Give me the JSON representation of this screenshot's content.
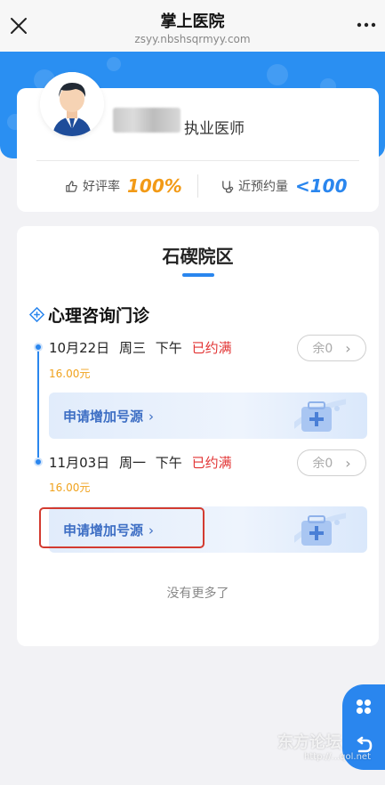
{
  "topbar": {
    "title": "掌上医院",
    "domain": "zsyy.nbshsqrmyy.com"
  },
  "doctor": {
    "title": "执业医师",
    "rating_label": "好评率",
    "rating_value": "100%",
    "booking_label": "近预约量",
    "booking_value": "<100"
  },
  "schedule": {
    "campus": "石碶院区",
    "department": "心理咨询门诊",
    "slots": [
      {
        "date": "10月22日",
        "weekday": "周三",
        "period": "下午",
        "status": "已约满",
        "price": "16.00元",
        "remain": "余0",
        "apply_label": "申请增加号源"
      },
      {
        "date": "11月03日",
        "weekday": "周一",
        "period": "下午",
        "status": "已约满",
        "price": "16.00元",
        "remain": "余0",
        "apply_label": "申请增加号源"
      }
    ],
    "no_more": "没有更多了"
  },
  "watermark": {
    "text": "东方论坛",
    "sub": "http://...qol.net"
  },
  "colors": {
    "brand_blue": "#2a86ee",
    "full_red": "#e23434",
    "price_orange": "#f0a21d",
    "rating_orange": "#f29a16"
  }
}
